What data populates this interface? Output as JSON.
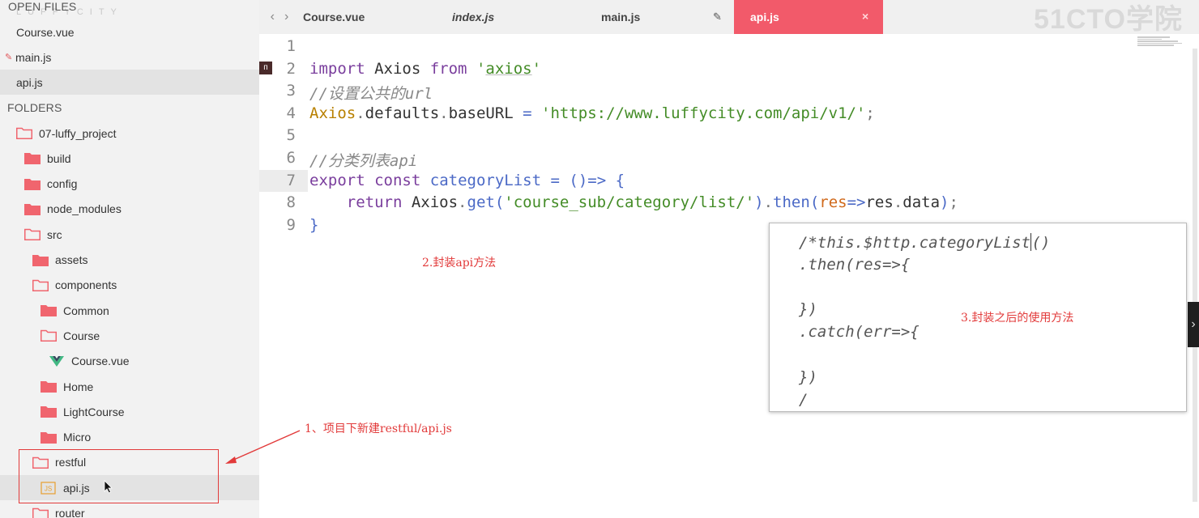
{
  "sidebar": {
    "logo_text": "LUFFYCITY",
    "open_files_header": "OPEN FILES",
    "open_files": [
      {
        "label": "Course.vue",
        "modified": false,
        "selected": false
      },
      {
        "label": "main.js",
        "modified": true,
        "selected": false
      },
      {
        "label": "api.js",
        "modified": false,
        "selected": true
      }
    ],
    "folders_header": "FOLDERS",
    "tree": [
      {
        "label": "07-luffy_project",
        "type": "folder-open",
        "depth": 0
      },
      {
        "label": "build",
        "type": "folder",
        "depth": 1
      },
      {
        "label": "config",
        "type": "folder",
        "depth": 1
      },
      {
        "label": "node_modules",
        "type": "folder",
        "depth": 1
      },
      {
        "label": "src",
        "type": "folder-open",
        "depth": 1
      },
      {
        "label": "assets",
        "type": "folder",
        "depth": 2
      },
      {
        "label": "components",
        "type": "folder-open",
        "depth": 2
      },
      {
        "label": "Common",
        "type": "folder",
        "depth": 3
      },
      {
        "label": "Course",
        "type": "folder-open",
        "depth": 3
      },
      {
        "label": "Course.vue",
        "type": "vue-file",
        "depth": 4
      },
      {
        "label": "Home",
        "type": "folder",
        "depth": 3
      },
      {
        "label": "LightCourse",
        "type": "folder",
        "depth": 3
      },
      {
        "label": "Micro",
        "type": "folder",
        "depth": 3
      },
      {
        "label": "restful",
        "type": "folder-open",
        "depth": 2
      },
      {
        "label": "api.js",
        "type": "js-file",
        "depth": 3
      },
      {
        "label": "router",
        "type": "folder-open",
        "depth": 2
      }
    ]
  },
  "tabs": [
    {
      "label": "Course.vue",
      "italic": false,
      "active": false
    },
    {
      "label": "index.js",
      "italic": true,
      "active": false
    },
    {
      "label": "main.js",
      "italic": false,
      "active": false
    },
    {
      "label": "api.js",
      "italic": false,
      "active": true
    }
  ],
  "watermark": "51CTO学院",
  "editor": {
    "line_numbers": [
      "1",
      "2",
      "3",
      "4",
      "5",
      "6",
      "7",
      "8",
      "9"
    ],
    "code": [
      [],
      [
        [
          "kw",
          "import"
        ],
        [
          "obj",
          " Axios "
        ],
        [
          "kw",
          "from"
        ],
        [
          "punc",
          " "
        ],
        [
          "str",
          "'"
        ],
        [
          "str",
          "axios"
        ],
        [
          "str",
          "'"
        ]
      ],
      [
        [
          "cmt",
          "//设置公共的url"
        ]
      ],
      [
        [
          "var",
          "Axios"
        ],
        [
          "punc",
          "."
        ],
        [
          "obj",
          "defaults"
        ],
        [
          "punc",
          "."
        ],
        [
          "obj",
          "baseURL "
        ],
        [
          "op",
          "= "
        ],
        [
          "str",
          "'https://www.luffycity.com/api/v1/'"
        ],
        [
          "punc",
          ";"
        ]
      ],
      [],
      [
        [
          "cmt",
          "//分类列表api"
        ]
      ],
      [
        [
          "kw",
          "export"
        ],
        [
          "obj",
          " "
        ],
        [
          "kw",
          "const"
        ],
        [
          "obj",
          " "
        ],
        [
          "fn",
          "categoryList"
        ],
        [
          "obj",
          " "
        ],
        [
          "op",
          "= "
        ],
        [
          "op",
          "()=>"
        ],
        [
          "obj",
          " "
        ],
        [
          "op",
          "{"
        ]
      ],
      [
        [
          "obj",
          "    "
        ],
        [
          "kw",
          "return"
        ],
        [
          "obj",
          " Axios"
        ],
        [
          "punc",
          "."
        ],
        [
          "fn",
          "get"
        ],
        [
          "op",
          "("
        ],
        [
          "str",
          "'course_sub/category/list/'"
        ],
        [
          "op",
          ")"
        ],
        [
          "punc",
          "."
        ],
        [
          "fn",
          "then"
        ],
        [
          "op",
          "("
        ],
        [
          "param",
          "res"
        ],
        [
          "op",
          "=>"
        ],
        [
          "obj",
          "res"
        ],
        [
          "punc",
          "."
        ],
        [
          "obj",
          "data"
        ],
        [
          "op",
          ")"
        ],
        [
          "punc",
          ";"
        ]
      ],
      [
        [
          "op",
          "}"
        ]
      ]
    ]
  },
  "overlay": {
    "lines": [
      "/*this.$http.categoryList()",
      ".then(res=>{",
      "",
      "})",
      ".catch(err=>{",
      "",
      "})",
      "/"
    ]
  },
  "annotations": {
    "step1": "1、项目下新建restful/api.js",
    "step2": "2.封装api方法",
    "step3": "3.封装之后的使用方法"
  },
  "colors": {
    "tab_active": "#f25a6a",
    "folder": "#f0656e",
    "annotation": "#e23a3a"
  }
}
